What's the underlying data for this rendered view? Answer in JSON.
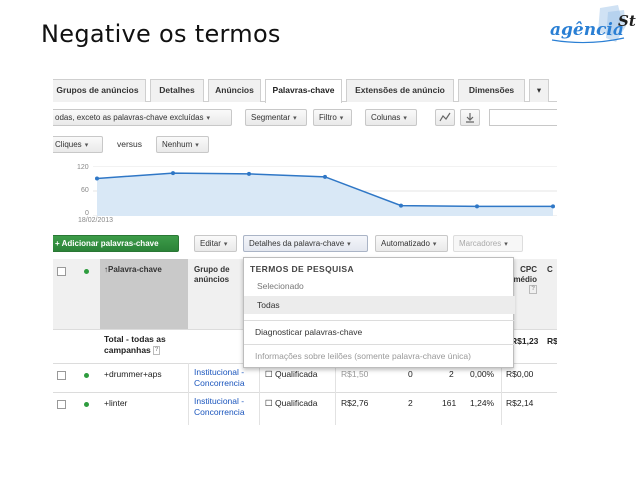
{
  "slide": {
    "title": "Negative os termos"
  },
  "logo": {
    "text_main": "agência",
    "text_suffix": "St"
  },
  "tabs": [
    {
      "label": "Grupos de anúncios",
      "active": false
    },
    {
      "label": "Detalhes",
      "active": false
    },
    {
      "label": "Anúncios",
      "active": false
    },
    {
      "label": "Palavras-chave",
      "active": true
    },
    {
      "label": "Extensões de anúncio",
      "active": false
    },
    {
      "label": "Dimensões",
      "active": false
    }
  ],
  "toolbar1": {
    "filter_select": "odas, exceto as palavras-chave excluídas",
    "segment": "Segmentar",
    "filter": "Filtro",
    "columns": "Colunas"
  },
  "toolbar2": {
    "metric1": "Cliques",
    "versus": "versus",
    "metric2": "Nenhum"
  },
  "chart": {
    "y_ticks": [
      "120",
      "60",
      "0"
    ],
    "x_tick": "18/02/2013"
  },
  "chart_data": {
    "type": "area",
    "x_start": "18/02/2013",
    "y_ticks": [
      0,
      60,
      120
    ],
    "ylim": [
      0,
      120
    ],
    "values": [
      90,
      103,
      101,
      94,
      25,
      23,
      23
    ],
    "grid": true,
    "line_color": "#2f77c6",
    "fill_color": "#d9e8f6"
  },
  "actions": {
    "add_keywords": "Adicionar palavras-chave",
    "edit": "Editar",
    "keyword_details": "Detalhes da palavra-chave",
    "automate": "Automatizado",
    "labels": "Marcadores"
  },
  "dropdown": {
    "header": "TERMOS DE PESQUISA",
    "items": [
      "Selecionado",
      "Todas",
      "Diagnosticar palavras-chave",
      "Informações sobre leilões (somente palavra-chave única)"
    ]
  },
  "table": {
    "headers": {
      "keyword": "Palavra-chave",
      "ad_group": "Grupo de anúncios",
      "cpc": "CPC médio",
      "c": "C"
    },
    "total_label": "Total - todas as campanhas",
    "total_cpc": "R$1,23",
    "total_cut": "R$",
    "rows": [
      {
        "keyword": "+drummer+aps",
        "group_line1": "Institucional -",
        "group_line2": "Concorrencia",
        "status": "Qualificada",
        "bid": "R$1,50",
        "clicks": "0",
        "impr": "2",
        "ctr": "0,00%",
        "cpc": "R$0,00"
      },
      {
        "keyword": "+linter",
        "group_line1": "Institucional -",
        "group_line2": "Concorrencia",
        "status": "Qualificada",
        "bid": "R$2,76",
        "clicks": "2",
        "impr": "161",
        "ctr": "1,24%",
        "cpc": "R$2,14"
      }
    ]
  },
  "colors": {
    "accent_green": "#2e9c3e",
    "link_blue": "#1a55bd",
    "chart_line": "#2f77c6",
    "logo_blue": "#2a7fd4"
  }
}
